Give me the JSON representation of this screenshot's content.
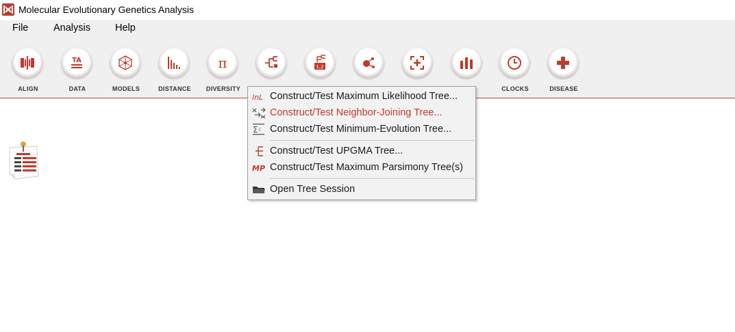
{
  "window": {
    "title": "Molecular Evolutionary Genetics Analysis",
    "app_icon": "mega-logo-icon"
  },
  "menubar": {
    "items": [
      "File",
      "Analysis",
      "Help"
    ]
  },
  "toolbar": {
    "tools": [
      {
        "label": "ALIGN",
        "icon": "align-icon"
      },
      {
        "label": "DATA",
        "icon": "data-icon"
      },
      {
        "label": "MODELS",
        "icon": "models-icon"
      },
      {
        "label": "DISTANCE",
        "icon": "distance-icon"
      },
      {
        "label": "DIVERSITY",
        "icon": "pi-icon"
      },
      {
        "label": "",
        "icon": "phylogeny-icon"
      },
      {
        "label": "",
        "icon": "user-tree-icon"
      },
      {
        "label": "",
        "icon": "ancestors-icon"
      },
      {
        "label": "",
        "icon": "selection-icon"
      },
      {
        "label": "",
        "icon": "rates-icon"
      },
      {
        "label": "CLOCKS",
        "icon": "clock-icon"
      },
      {
        "label": "DISEASE",
        "icon": "plus-cross-icon"
      }
    ]
  },
  "dropdown": {
    "items": [
      {
        "label": "Construct/Test Maximum Likelihood Tree...",
        "icon": "ml-icon"
      },
      {
        "label": "Construct/Test Neighbor-Joining Tree...",
        "icon": "nj-icon",
        "highlighted": true
      },
      {
        "label": "Construct/Test Minimum-Evolution Tree...",
        "icon": "me-icon"
      },
      {
        "label": "Construct/Test UPGMA Tree...",
        "icon": "upgma-icon"
      },
      {
        "label": "Construct/Test Maximum Parsimony Tree(s)",
        "icon": "mp-icon"
      },
      {
        "label": "Open Tree Session",
        "icon": "folder-icon"
      }
    ]
  },
  "desktop": {
    "notes_icon": "notes-icon"
  },
  "colors": {
    "accent": "#c0392b",
    "toolbar_bg": "#f0f0f0",
    "menu_bg": "#f2f2f2"
  }
}
